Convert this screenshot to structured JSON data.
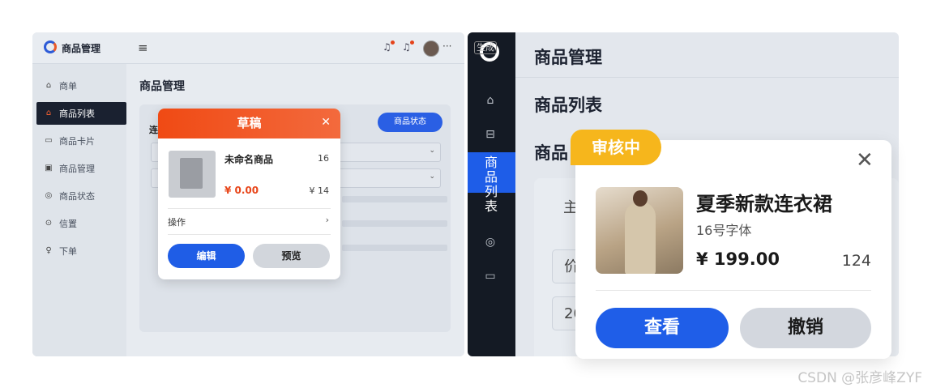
{
  "left": {
    "app_title": "商品管理",
    "header_more": "···",
    "sidebar": [
      {
        "label": "商单",
        "icon": "home-icon",
        "glyph": "⌂"
      },
      {
        "label": "商品列表",
        "icon": "home-icon",
        "glyph": "⌂",
        "active": true
      },
      {
        "label": "商品卡片",
        "icon": "card-icon",
        "glyph": "▭"
      },
      {
        "label": "商品管理",
        "icon": "box-icon",
        "glyph": "▣"
      },
      {
        "label": "商品状态",
        "icon": "status-icon",
        "glyph": "◎"
      },
      {
        "label": "信置",
        "icon": "settings-icon",
        "glyph": "⊙"
      },
      {
        "label": "下单",
        "icon": "user-icon",
        "glyph": "♀"
      }
    ],
    "page_title": "商品管理",
    "card_label": "连",
    "status_button": "商品状态",
    "popup": {
      "title": "草稿",
      "product_name": "未命名商品",
      "font_size_value": "16",
      "price": "¥ 0.00",
      "secondary_value": "¥ 14",
      "actions_label": "操作",
      "edit_button": "编辑",
      "preview_button": "预览"
    }
  },
  "right": {
    "logo_text": "生成",
    "active_nav": "商品列表",
    "header_title": "商品管理",
    "section_title": "商品列表",
    "partial_title": "商品",
    "bg_cells": [
      "价",
      "20"
    ],
    "bg_text": "主",
    "popup": {
      "badge": "审核中",
      "product_name": "夏季新款连衣裙",
      "subtitle": "16号字体",
      "price": "¥ 199.00",
      "count": "124",
      "view_button": "查看",
      "revoke_button": "撤销"
    }
  },
  "watermark": "CSDN @张彦峰ZYF",
  "colors": {
    "accent_blue": "#1f5ee8",
    "draft_orange": "#f04a14",
    "review_yellow": "#f6b61c",
    "sidebar_dark": "#141a24"
  }
}
